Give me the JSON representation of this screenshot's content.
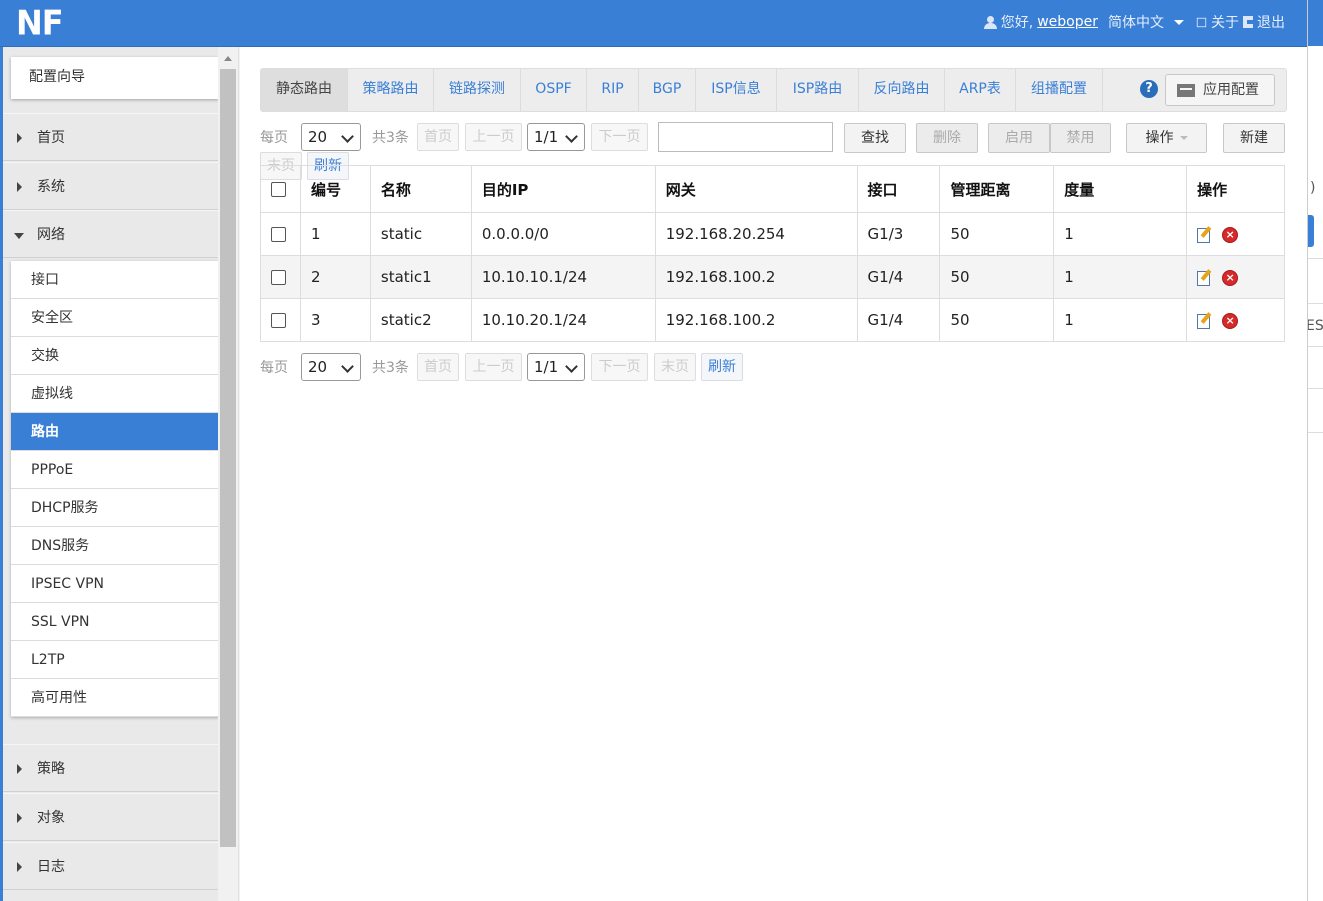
{
  "header": {
    "logo": "NF",
    "greeting": "您好,",
    "username": "weboper",
    "language": "简体中文",
    "about": "关于",
    "logout": "退出"
  },
  "sidebar": {
    "wizard": "配置向导",
    "groups_top": [
      {
        "label": "首页",
        "expanded": false
      },
      {
        "label": "系统",
        "expanded": false
      },
      {
        "label": "网络",
        "expanded": true
      }
    ],
    "network_items": [
      {
        "label": "接口",
        "active": false
      },
      {
        "label": "安全区",
        "active": false
      },
      {
        "label": "交换",
        "active": false
      },
      {
        "label": "虚拟线",
        "active": false
      },
      {
        "label": "路由",
        "active": true
      },
      {
        "label": "PPPoE",
        "active": false
      },
      {
        "label": "DHCP服务",
        "active": false
      },
      {
        "label": "DNS服务",
        "active": false
      },
      {
        "label": "IPSEC VPN",
        "active": false
      },
      {
        "label": "SSL VPN",
        "active": false
      },
      {
        "label": "L2TP",
        "active": false
      },
      {
        "label": "高可用性",
        "active": false
      }
    ],
    "groups_bottom": [
      {
        "label": "策略"
      },
      {
        "label": "对象"
      },
      {
        "label": "日志"
      }
    ]
  },
  "tabs": [
    {
      "label": "静态路由",
      "active": true
    },
    {
      "label": "策略路由"
    },
    {
      "label": "链路探测"
    },
    {
      "label": "OSPF"
    },
    {
      "label": "RIP"
    },
    {
      "label": "BGP"
    },
    {
      "label": "ISP信息"
    },
    {
      "label": "ISP路由"
    },
    {
      "label": "反向路由"
    },
    {
      "label": "ARP表"
    },
    {
      "label": "组播配置"
    }
  ],
  "help_icon": "?",
  "apply_button": "应用配置",
  "pager": {
    "per_page_label": "每页",
    "per_page_value": "20",
    "total": "共3条",
    "first": "首页",
    "prev": "上一页",
    "page_value": "1/1",
    "next": "下一页",
    "last": "末页",
    "refresh": "刷新"
  },
  "toolbar": {
    "search_value": "",
    "search_button": "查找",
    "delete_button": "删除",
    "enable_button": "启用",
    "disable_button": "禁用",
    "actions_button": "操作",
    "new_button": "新建"
  },
  "table": {
    "headers": [
      "编号",
      "名称",
      "目的IP",
      "网关",
      "接口",
      "管理距离",
      "度量",
      "操作"
    ],
    "rows": [
      {
        "id": "1",
        "name": "static",
        "dest": "0.0.0.0/0",
        "gateway": "192.168.20.254",
        "iface": "G1/3",
        "distance": "50",
        "metric": "1"
      },
      {
        "id": "2",
        "name": "static1",
        "dest": "10.10.10.1/24",
        "gateway": "192.168.100.2",
        "iface": "G1/4",
        "distance": "50",
        "metric": "1"
      },
      {
        "id": "3",
        "name": "static2",
        "dest": "10.10.20.1/24",
        "gateway": "192.168.100.2",
        "iface": "G1/4",
        "distance": "50",
        "metric": "1"
      }
    ]
  },
  "background_fragments": {
    "frag1": ")",
    "frag2": "ES"
  },
  "colors": {
    "accent": "#3a7fd6",
    "delete_icon": "#d52a2a"
  }
}
